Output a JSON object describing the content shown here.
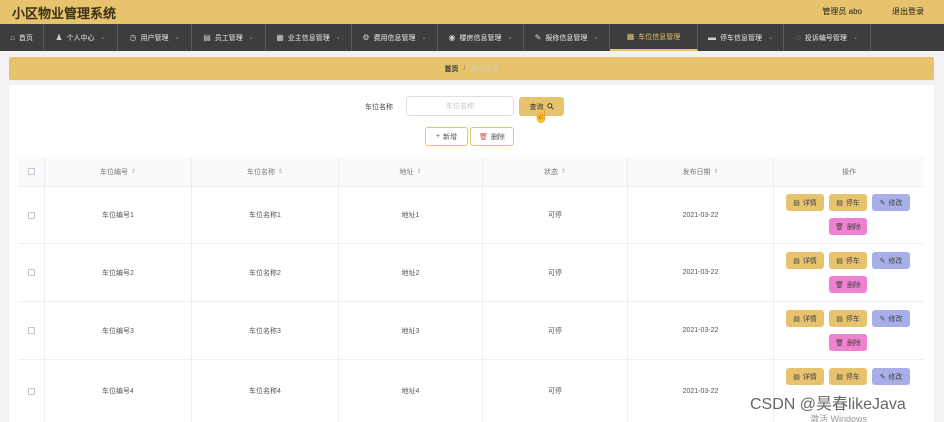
{
  "app": {
    "title": "小区物业管理系统",
    "admin": "管理员 abo",
    "logout": "退出登录"
  },
  "nav": [
    {
      "icon": "home-icon",
      "glyph": "⌂",
      "label": "首页",
      "chevron": ""
    },
    {
      "icon": "person-icon",
      "glyph": "♟",
      "label": "个人中心",
      "chevron": "⌄"
    },
    {
      "icon": "clock-icon",
      "glyph": "◷",
      "label": "用户管理",
      "chevron": "⌄"
    },
    {
      "icon": "doc-icon",
      "glyph": "▤",
      "label": "员工管理",
      "chevron": "⌄"
    },
    {
      "icon": "list-icon",
      "glyph": "▦",
      "label": "业主信息管理",
      "chevron": "⌄"
    },
    {
      "icon": "gear-icon",
      "glyph": "⚙",
      "label": "费用信息管理",
      "chevron": "⌄"
    },
    {
      "icon": "check-icon",
      "glyph": "◉",
      "label": "楼房信息管理",
      "chevron": "⌄"
    },
    {
      "icon": "edit-icon",
      "glyph": "✎",
      "label": "报修信息管理",
      "chevron": "⌄"
    },
    {
      "icon": "grid-icon",
      "glyph": "▦",
      "label": "车位信息管理",
      "chevron": ""
    },
    {
      "icon": "car-icon",
      "glyph": "▬",
      "label": "停车信息管理",
      "chevron": "⌄"
    },
    {
      "icon": "chat-icon",
      "glyph": "◌",
      "label": "投诉编号管理",
      "chevron": "⌄"
    }
  ],
  "breadcrumb": {
    "home": "首页",
    "sep": "/",
    "current": "车位信息"
  },
  "search": {
    "label": "车位名称",
    "placeholder": "车位名称",
    "button": "查询",
    "icon": "search-icon"
  },
  "actions": {
    "add": "新增",
    "delete": "删除"
  },
  "table": {
    "headers": [
      "车位编号",
      "车位名称",
      "地址",
      "状态",
      "发布日期",
      "操作"
    ],
    "rows": [
      {
        "code": "车位编号1",
        "name": "车位名称1",
        "address": "地址1",
        "status": "可停",
        "date": "2021-03-22"
      },
      {
        "code": "车位编号2",
        "name": "车位名称2",
        "address": "地址2",
        "status": "可停",
        "date": "2021-03-22"
      },
      {
        "code": "车位编号3",
        "name": "车位名称3",
        "address": "地址3",
        "status": "可停",
        "date": "2021-03-22"
      },
      {
        "code": "车位编号4",
        "name": "车位名称4",
        "address": "地址4",
        "status": "可停",
        "date": "2021-03-22"
      }
    ],
    "row_buttons": {
      "detail": "详情",
      "park": "停车",
      "edit": "修改",
      "remove": "删除"
    }
  },
  "overlay": {
    "watermark": "CSDN @昊春likeJava",
    "activate": "激活 Windows"
  },
  "colors": {
    "accent": "#e6c36c",
    "nav_bg": "#3d3d3d",
    "edit": "#a8aee8",
    "remove": "#ee82d0"
  }
}
